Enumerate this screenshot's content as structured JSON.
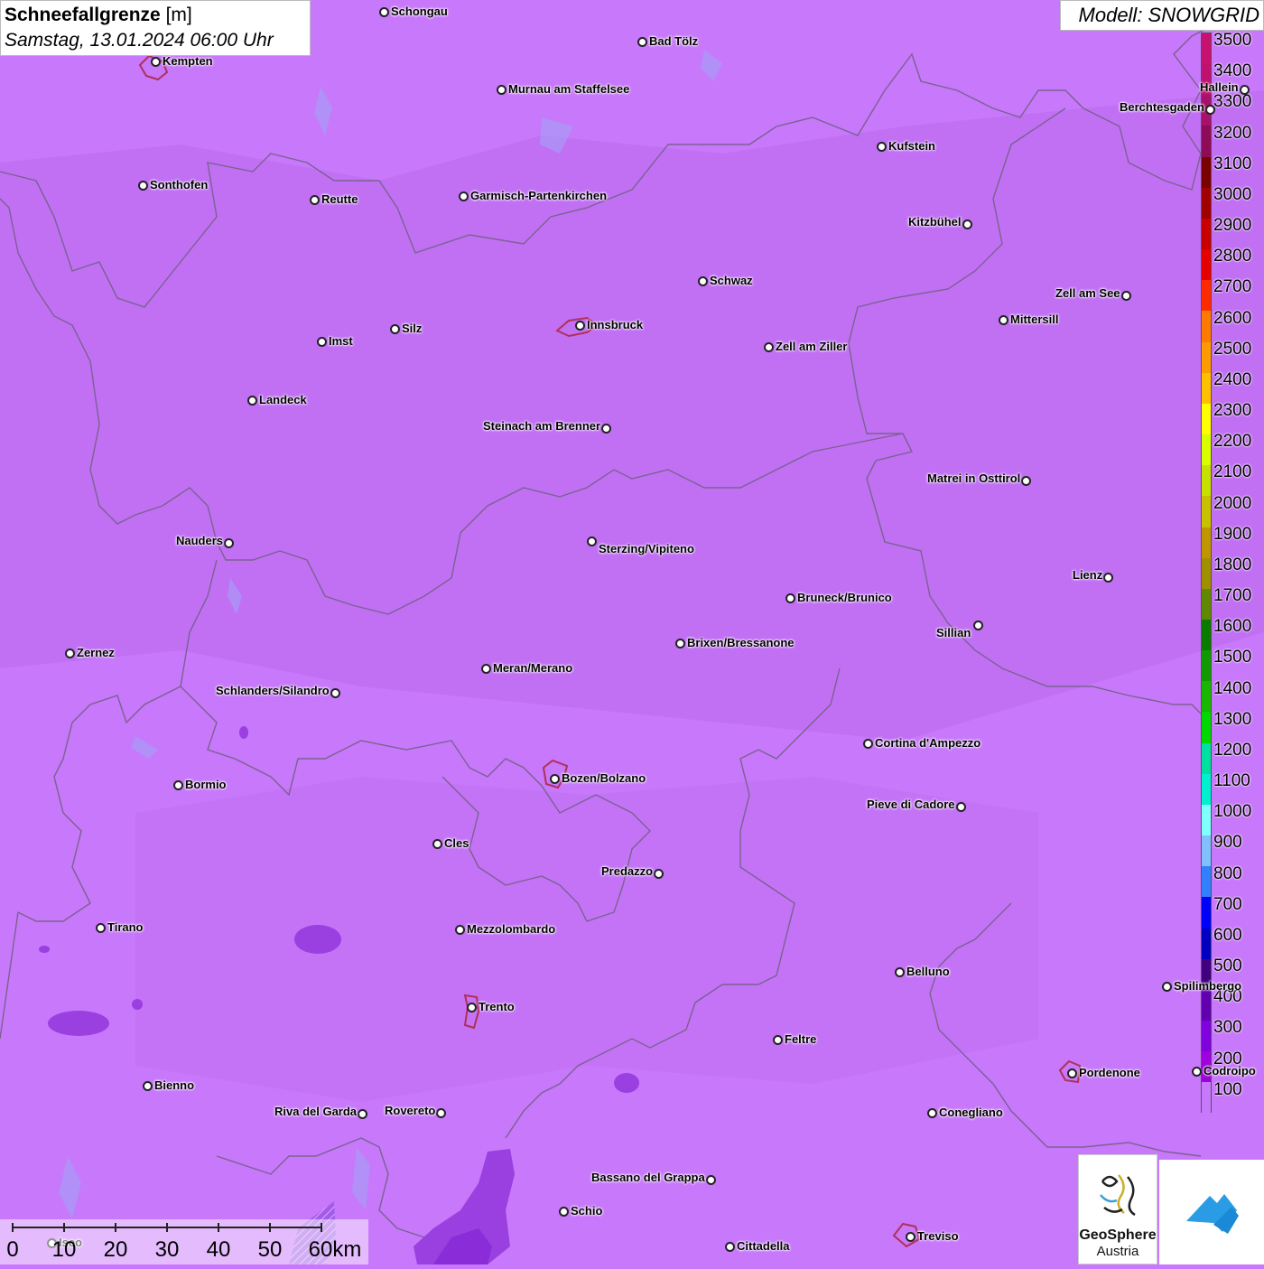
{
  "header": {
    "title_bold": "Schneefallgrenze",
    "title_unit": " [m]",
    "date": "Samstag, 13.01.2024 06:00 Uhr",
    "model": "Modell: SNOWGRID"
  },
  "colors": {
    "background": "#c878fa",
    "border": "#7a6290",
    "city_outline": "#b0305a",
    "low_blob": "#9a3fe0",
    "low_blob_dark": "#8a2cd8"
  },
  "legend": {
    "stops": [
      {
        "label": "3500",
        "color": "#c8106e"
      },
      {
        "label": "3400",
        "color": "#c01070"
      },
      {
        "label": "3300",
        "color": "#a8106a"
      },
      {
        "label": "3200",
        "color": "#900a5a"
      },
      {
        "label": "3100",
        "color": "#7a0000"
      },
      {
        "label": "3000",
        "color": "#a00000"
      },
      {
        "label": "2900",
        "color": "#c80000"
      },
      {
        "label": "2800",
        "color": "#e60000"
      },
      {
        "label": "2700",
        "color": "#ff2a00"
      },
      {
        "label": "2600",
        "color": "#ff7a00"
      },
      {
        "label": "2500",
        "color": "#ff9a00"
      },
      {
        "label": "2400",
        "color": "#ffc000"
      },
      {
        "label": "2300",
        "color": "#ffff00"
      },
      {
        "label": "2200",
        "color": "#d8ff00"
      },
      {
        "label": "2100",
        "color": "#c8e000"
      },
      {
        "label": "2000",
        "color": "#c8c000"
      },
      {
        "label": "1900",
        "color": "#c09600"
      },
      {
        "label": "1800",
        "color": "#a09000"
      },
      {
        "label": "1700",
        "color": "#608800"
      },
      {
        "label": "1600",
        "color": "#0a7a00"
      },
      {
        "label": "1500",
        "color": "#109a00"
      },
      {
        "label": "1400",
        "color": "#18b800"
      },
      {
        "label": "1300",
        "color": "#00d800"
      },
      {
        "label": "1200",
        "color": "#00e0a0"
      },
      {
        "label": "1100",
        "color": "#00f0d0"
      },
      {
        "label": "1000",
        "color": "#80ffff"
      },
      {
        "label": "900",
        "color": "#80c0ff"
      },
      {
        "label": "800",
        "color": "#3080ff"
      },
      {
        "label": "700",
        "color": "#0000ff"
      },
      {
        "label": "600",
        "color": "#0000c0"
      },
      {
        "label": "500",
        "color": "#400080"
      },
      {
        "label": "400",
        "color": "#6000b0"
      },
      {
        "label": "300",
        "color": "#8000e0"
      },
      {
        "label": "200",
        "color": "#a000e0"
      },
      {
        "label": "100",
        "color": "#c878fa"
      }
    ]
  },
  "cities": [
    {
      "name": "Schongau"
    },
    {
      "name": "Kempten"
    },
    {
      "name": "Bad Tölz"
    },
    {
      "name": "Murnau am Staffelsee"
    },
    {
      "name": "Hallein"
    },
    {
      "name": "Berchtesgaden"
    },
    {
      "name": "Kufstein"
    },
    {
      "name": "Sonthofen"
    },
    {
      "name": "Reutte"
    },
    {
      "name": "Garmisch-Partenkirchen"
    },
    {
      "name": "Kitzbühel"
    },
    {
      "name": "Schwaz"
    },
    {
      "name": "Zell am See"
    },
    {
      "name": "Mittersill"
    },
    {
      "name": "Innsbruck"
    },
    {
      "name": "Imst"
    },
    {
      "name": "Silz"
    },
    {
      "name": "Zell am Ziller"
    },
    {
      "name": "Landeck"
    },
    {
      "name": "Steinach am Brenner"
    },
    {
      "name": "Matrei in Osttirol"
    },
    {
      "name": "Nauders"
    },
    {
      "name": "Sterzing/Vipiteno"
    },
    {
      "name": "Lienz"
    },
    {
      "name": "Bruneck/Brunico"
    },
    {
      "name": "Sillian"
    },
    {
      "name": "Zernez"
    },
    {
      "name": "Brixen/Bressanone"
    },
    {
      "name": "Meran/Merano"
    },
    {
      "name": "Schlanders/Silandro"
    },
    {
      "name": "Cortina d'Ampezzo"
    },
    {
      "name": "Bormio"
    },
    {
      "name": "Bozen/Bolzano"
    },
    {
      "name": "Pieve di Cadore"
    },
    {
      "name": "Cles"
    },
    {
      "name": "Predazzo"
    },
    {
      "name": "Tirano"
    },
    {
      "name": "Mezzolombardo"
    },
    {
      "name": "Belluno"
    },
    {
      "name": "Spilimbergo"
    },
    {
      "name": "Trento"
    },
    {
      "name": "Feltre"
    },
    {
      "name": "Pordenone"
    },
    {
      "name": "Codroipo"
    },
    {
      "name": "Bienno"
    },
    {
      "name": "Riva del Garda"
    },
    {
      "name": "Rovereto"
    },
    {
      "name": "Conegliano"
    },
    {
      "name": "Bassano del Grappa"
    },
    {
      "name": "Schio"
    },
    {
      "name": "Iseo"
    },
    {
      "name": "Treviso"
    },
    {
      "name": "Cittadella"
    }
  ],
  "scale": {
    "labels": [
      "0",
      "10",
      "20",
      "30",
      "40",
      "50",
      "60km"
    ]
  },
  "logos": {
    "org_line1": "GeoSphere",
    "org_line2": "Austria"
  }
}
